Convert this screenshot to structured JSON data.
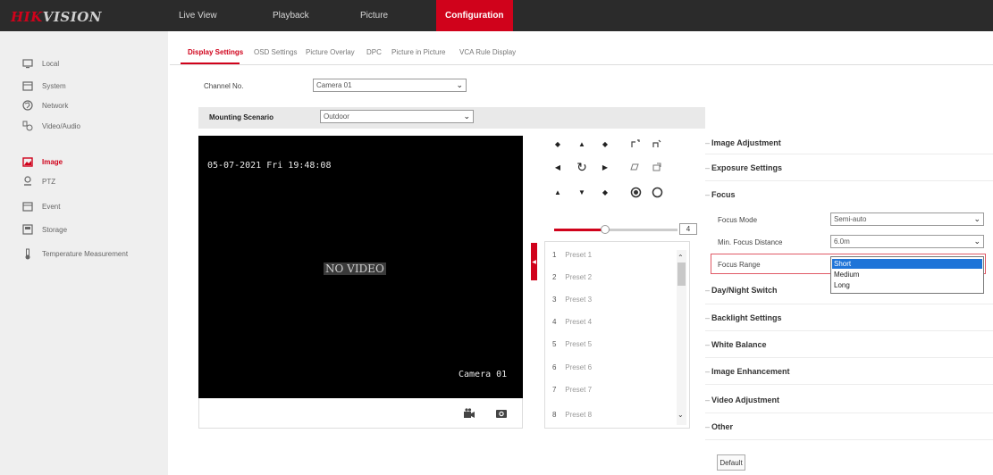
{
  "brand": {
    "hik": "HIK",
    "vision": "VISION"
  },
  "nav": [
    "Live View",
    "Playback",
    "Picture",
    "Configuration"
  ],
  "sidebar": [
    {
      "label": "Local",
      "icon": "monitor-icon"
    },
    {
      "label": "System",
      "icon": "system-icon"
    },
    {
      "label": "Network",
      "icon": "globe-icon"
    },
    {
      "label": "Video/Audio",
      "icon": "video-audio-icon"
    },
    {
      "label": "Image",
      "icon": "image-icon"
    },
    {
      "label": "PTZ",
      "icon": "ptz-icon"
    },
    {
      "label": "Event",
      "icon": "event-icon"
    },
    {
      "label": "Storage",
      "icon": "storage-icon"
    },
    {
      "label": "Temperature Measurement",
      "icon": "thermometer-icon"
    }
  ],
  "tabs": [
    "Display Settings",
    "OSD Settings",
    "Picture Overlay",
    "DPC",
    "Picture in Picture",
    "VCA Rule Display"
  ],
  "channel": {
    "label": "Channel No.",
    "value": "Camera 01"
  },
  "scenario": {
    "label": "Mounting Scenario",
    "value": "Outdoor"
  },
  "video": {
    "timestamp": "05-07-2021 Fri 19:48:08",
    "no_video": "NO VIDEO",
    "camera_name": "Camera 01"
  },
  "ptz": {
    "speed": "4"
  },
  "presets": [
    {
      "num": "1",
      "name": "Preset 1"
    },
    {
      "num": "2",
      "name": "Preset 2"
    },
    {
      "num": "3",
      "name": "Preset 3"
    },
    {
      "num": "4",
      "name": "Preset 4"
    },
    {
      "num": "5",
      "name": "Preset 5"
    },
    {
      "num": "6",
      "name": "Preset 6"
    },
    {
      "num": "7",
      "name": "Preset 7"
    },
    {
      "num": "8",
      "name": "Preset 8"
    }
  ],
  "sections": {
    "image_adjustment": "Image Adjustment",
    "exposure": "Exposure Settings",
    "focus": "Focus",
    "day_night": "Day/Night Switch",
    "backlight": "Backlight Settings",
    "white_balance": "White Balance",
    "image_enhancement": "Image Enhancement",
    "video_adjustment": "Video Adjustment",
    "other": "Other"
  },
  "focus": {
    "mode_label": "Focus Mode",
    "mode_value": "Semi-auto",
    "distance_label": "Min. Focus Distance",
    "distance_value": "6.0m",
    "range_label": "Focus Range",
    "range_options": [
      "Short",
      "Medium",
      "Long"
    ]
  },
  "default_button": "Default",
  "colors": {
    "accent": "#d0021b",
    "selection": "#1e74d8"
  }
}
